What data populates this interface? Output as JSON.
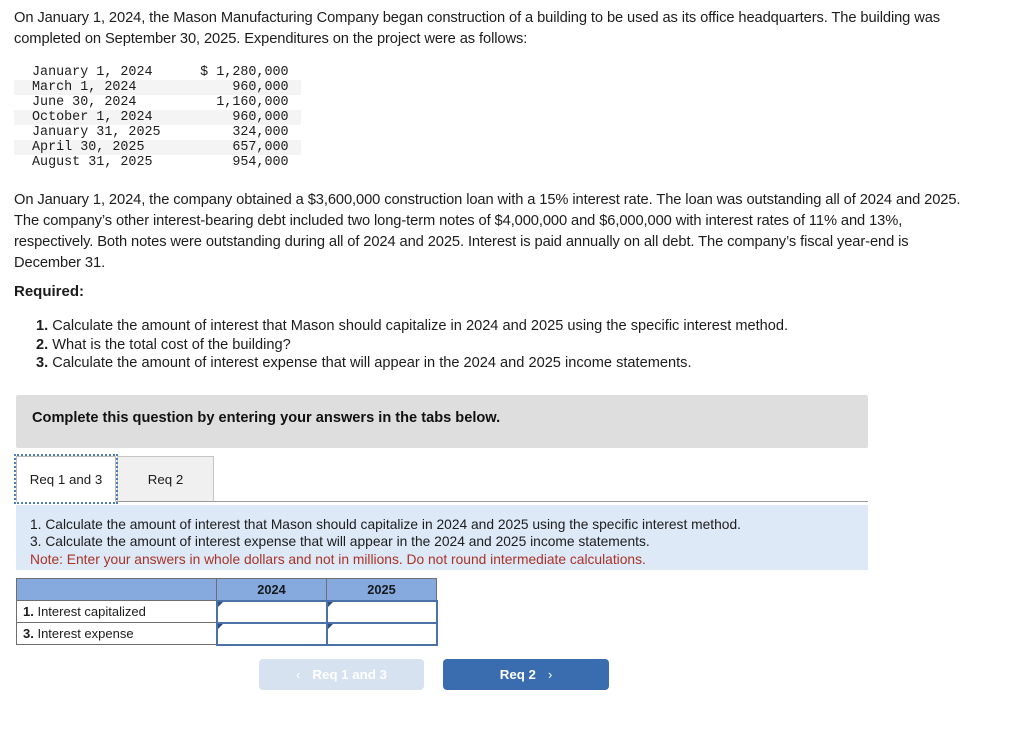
{
  "intro": {
    "paragraph": "On January 1, 2024, the Mason Manufacturing Company began construction of a building to be used as its office headquarters. The building was completed on September 30, 2025. Expenditures on the project were as follows:"
  },
  "expenditures": {
    "rows": [
      {
        "date": "January 1, 2024",
        "amount": "$ 1,280,000"
      },
      {
        "date": "March 1, 2024",
        "amount": "960,000"
      },
      {
        "date": "June 30, 2024",
        "amount": "1,160,000"
      },
      {
        "date": "October 1, 2024",
        "amount": "960,000"
      },
      {
        "date": "January 31, 2025",
        "amount": "324,000"
      },
      {
        "date": "April 30, 2025",
        "amount": "657,000"
      },
      {
        "date": "August 31, 2025",
        "amount": "954,000"
      }
    ]
  },
  "loan": {
    "paragraph": "On January 1, 2024, the company obtained a $3,600,000 construction loan with a 15% interest rate. The loan was outstanding all of 2024 and 2025. The company’s other interest-bearing debt included two long-term notes of $4,000,000 and $6,000,000 with interest rates of 11% and 13%, respectively. Both notes were outstanding during all of 2024 and 2025. Interest is paid annually on all debt. The company’s fiscal year-end is December 31."
  },
  "required": {
    "label": "Required:",
    "items": [
      {
        "num": "1.",
        "text": "Calculate the amount of interest that Mason should capitalize in 2024 and 2025 using the specific interest method."
      },
      {
        "num": "2.",
        "text": "What is the total cost of the building?"
      },
      {
        "num": "3.",
        "text": "Calculate the amount of interest expense that will appear in the 2024 and 2025 income statements."
      }
    ]
  },
  "banner": {
    "text": "Complete this question by entering your answers in the tabs below."
  },
  "tabs": [
    {
      "label": "Req 1 and 3",
      "active": true
    },
    {
      "label": "Req 2",
      "active": false
    }
  ],
  "info_panel": {
    "line1": "1. Calculate the amount of interest that Mason should capitalize in 2024 and 2025 using the specific interest method.",
    "line2": "3. Calculate the amount of interest expense that will appear in the 2024 and 2025 income statements.",
    "note": "Note: Enter your answers in whole dollars and not in millions. Do not round intermediate calculations.",
    "note_color": "#a93226",
    "background_color": "#dde9f7"
  },
  "answer_table": {
    "header": {
      "blank": "",
      "year1": "2024",
      "year2": "2025"
    },
    "rows": [
      {
        "num": "1.",
        "label": " Interest capitalized",
        "year1_value": "",
        "year2_value": ""
      },
      {
        "num": "3.",
        "label": " Interest expense",
        "year1_value": "",
        "year2_value": ""
      }
    ],
    "header_color": "#87aade"
  },
  "nav": {
    "prev": {
      "label": "Req 1 and 3",
      "chevron": "‹",
      "color": "#d7e2f0"
    },
    "next": {
      "label": "Req 2",
      "chevron": "›",
      "color": "#3a6cb0"
    }
  }
}
